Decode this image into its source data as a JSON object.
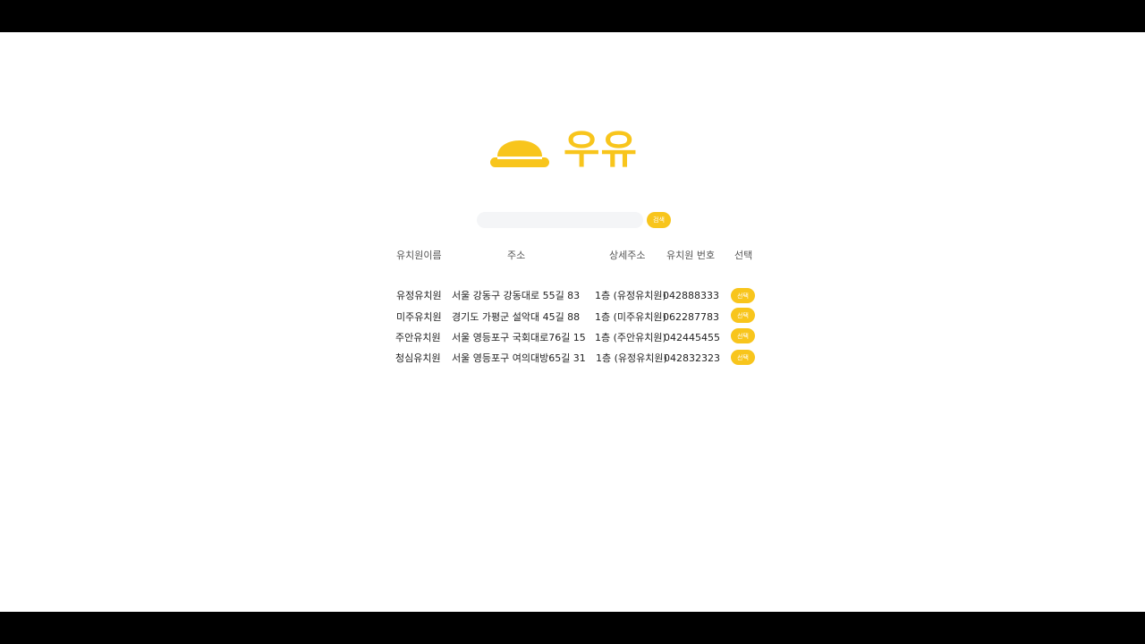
{
  "brand": {
    "name": "우유",
    "color": "#F8C51C",
    "logo_icon": "hard-hat-icon"
  },
  "search": {
    "placeholder": "",
    "value": "",
    "button_label": "검색"
  },
  "table": {
    "headers": [
      "유치원이름",
      "주소",
      "상세주소",
      "유치원 번호",
      "선택"
    ],
    "rows": [
      {
        "name": "유정유치원",
        "address": "서울 강동구 강동대로 55길 83",
        "detail": "1층 (유정유치원)",
        "number": "042888333",
        "select_label": "선택"
      },
      {
        "name": "미주유치원",
        "address": "경기도 가평군 설악대 45길  88",
        "detail": "1층 (미주유치원)",
        "number": "062287783",
        "select_label": "선택"
      },
      {
        "name": "주안유치원",
        "address": "서울 영등포구 국회대로76길 15",
        "detail": "1층 (주안유치원)",
        "number": "042445455",
        "select_label": "선택"
      },
      {
        "name": "청심유치원",
        "address": "서울 영등포구 여의대방65길 31",
        "detail": "1층 (유정유치원)",
        "number": "042832323",
        "select_label": "선택"
      }
    ]
  }
}
